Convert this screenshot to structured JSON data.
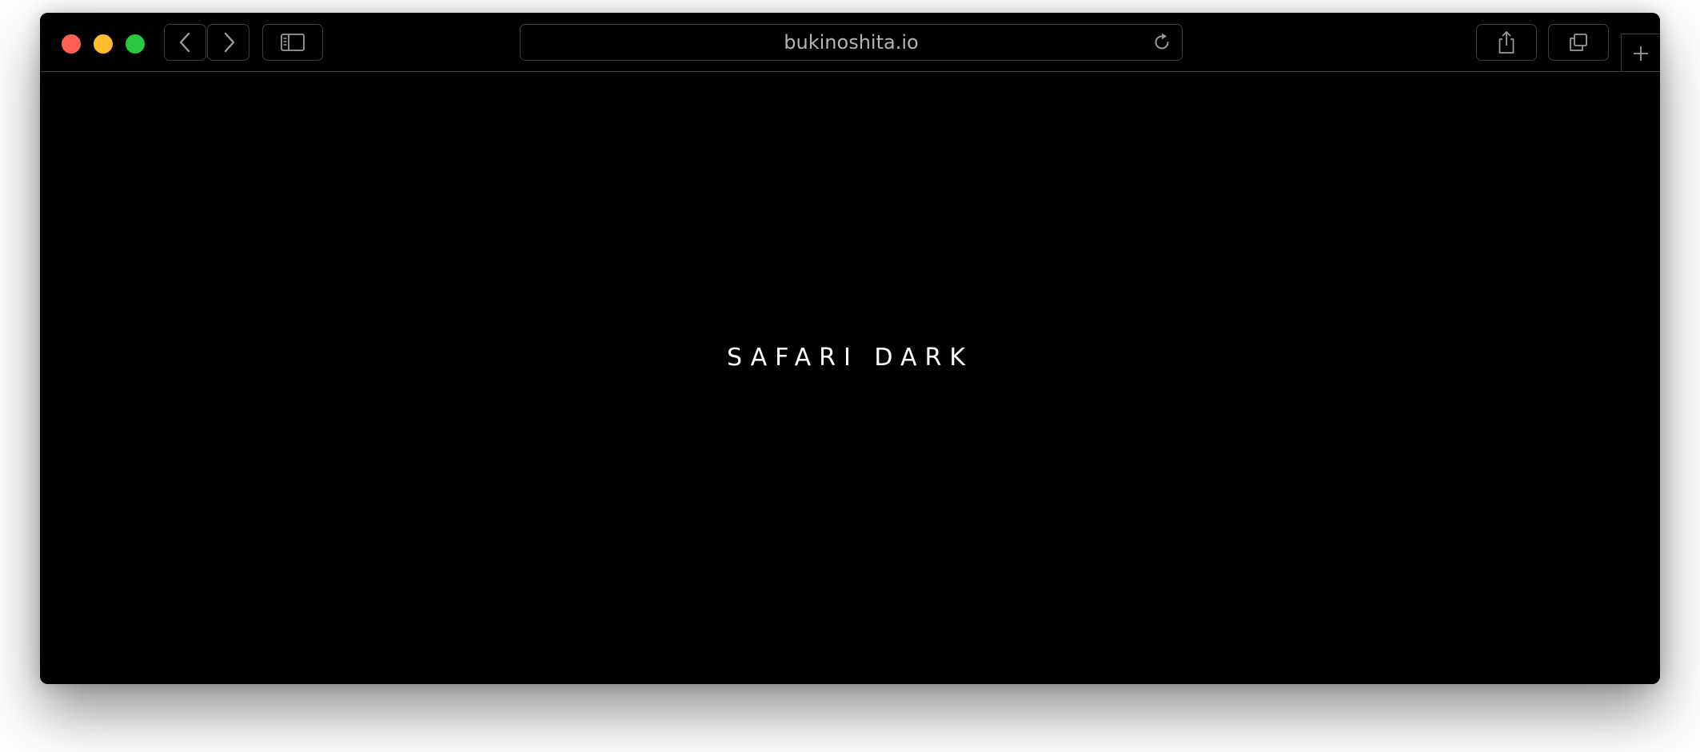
{
  "window": {
    "traffic_lights": {
      "close_color": "#ff5f57",
      "minimize_color": "#febc2e",
      "zoom_color": "#28c840"
    },
    "toolbar": {
      "back_icon": "chevron-left-icon",
      "forward_icon": "chevron-right-icon",
      "sidebar_icon": "sidebar-icon",
      "share_icon": "share-icon",
      "tabs_icon": "tabs-overview-icon",
      "new_tab_icon": "plus-icon"
    },
    "address_bar": {
      "url": "bukinoshita.io",
      "reload_icon": "reload-icon"
    }
  },
  "page": {
    "headline": "SAFARI DARK"
  }
}
